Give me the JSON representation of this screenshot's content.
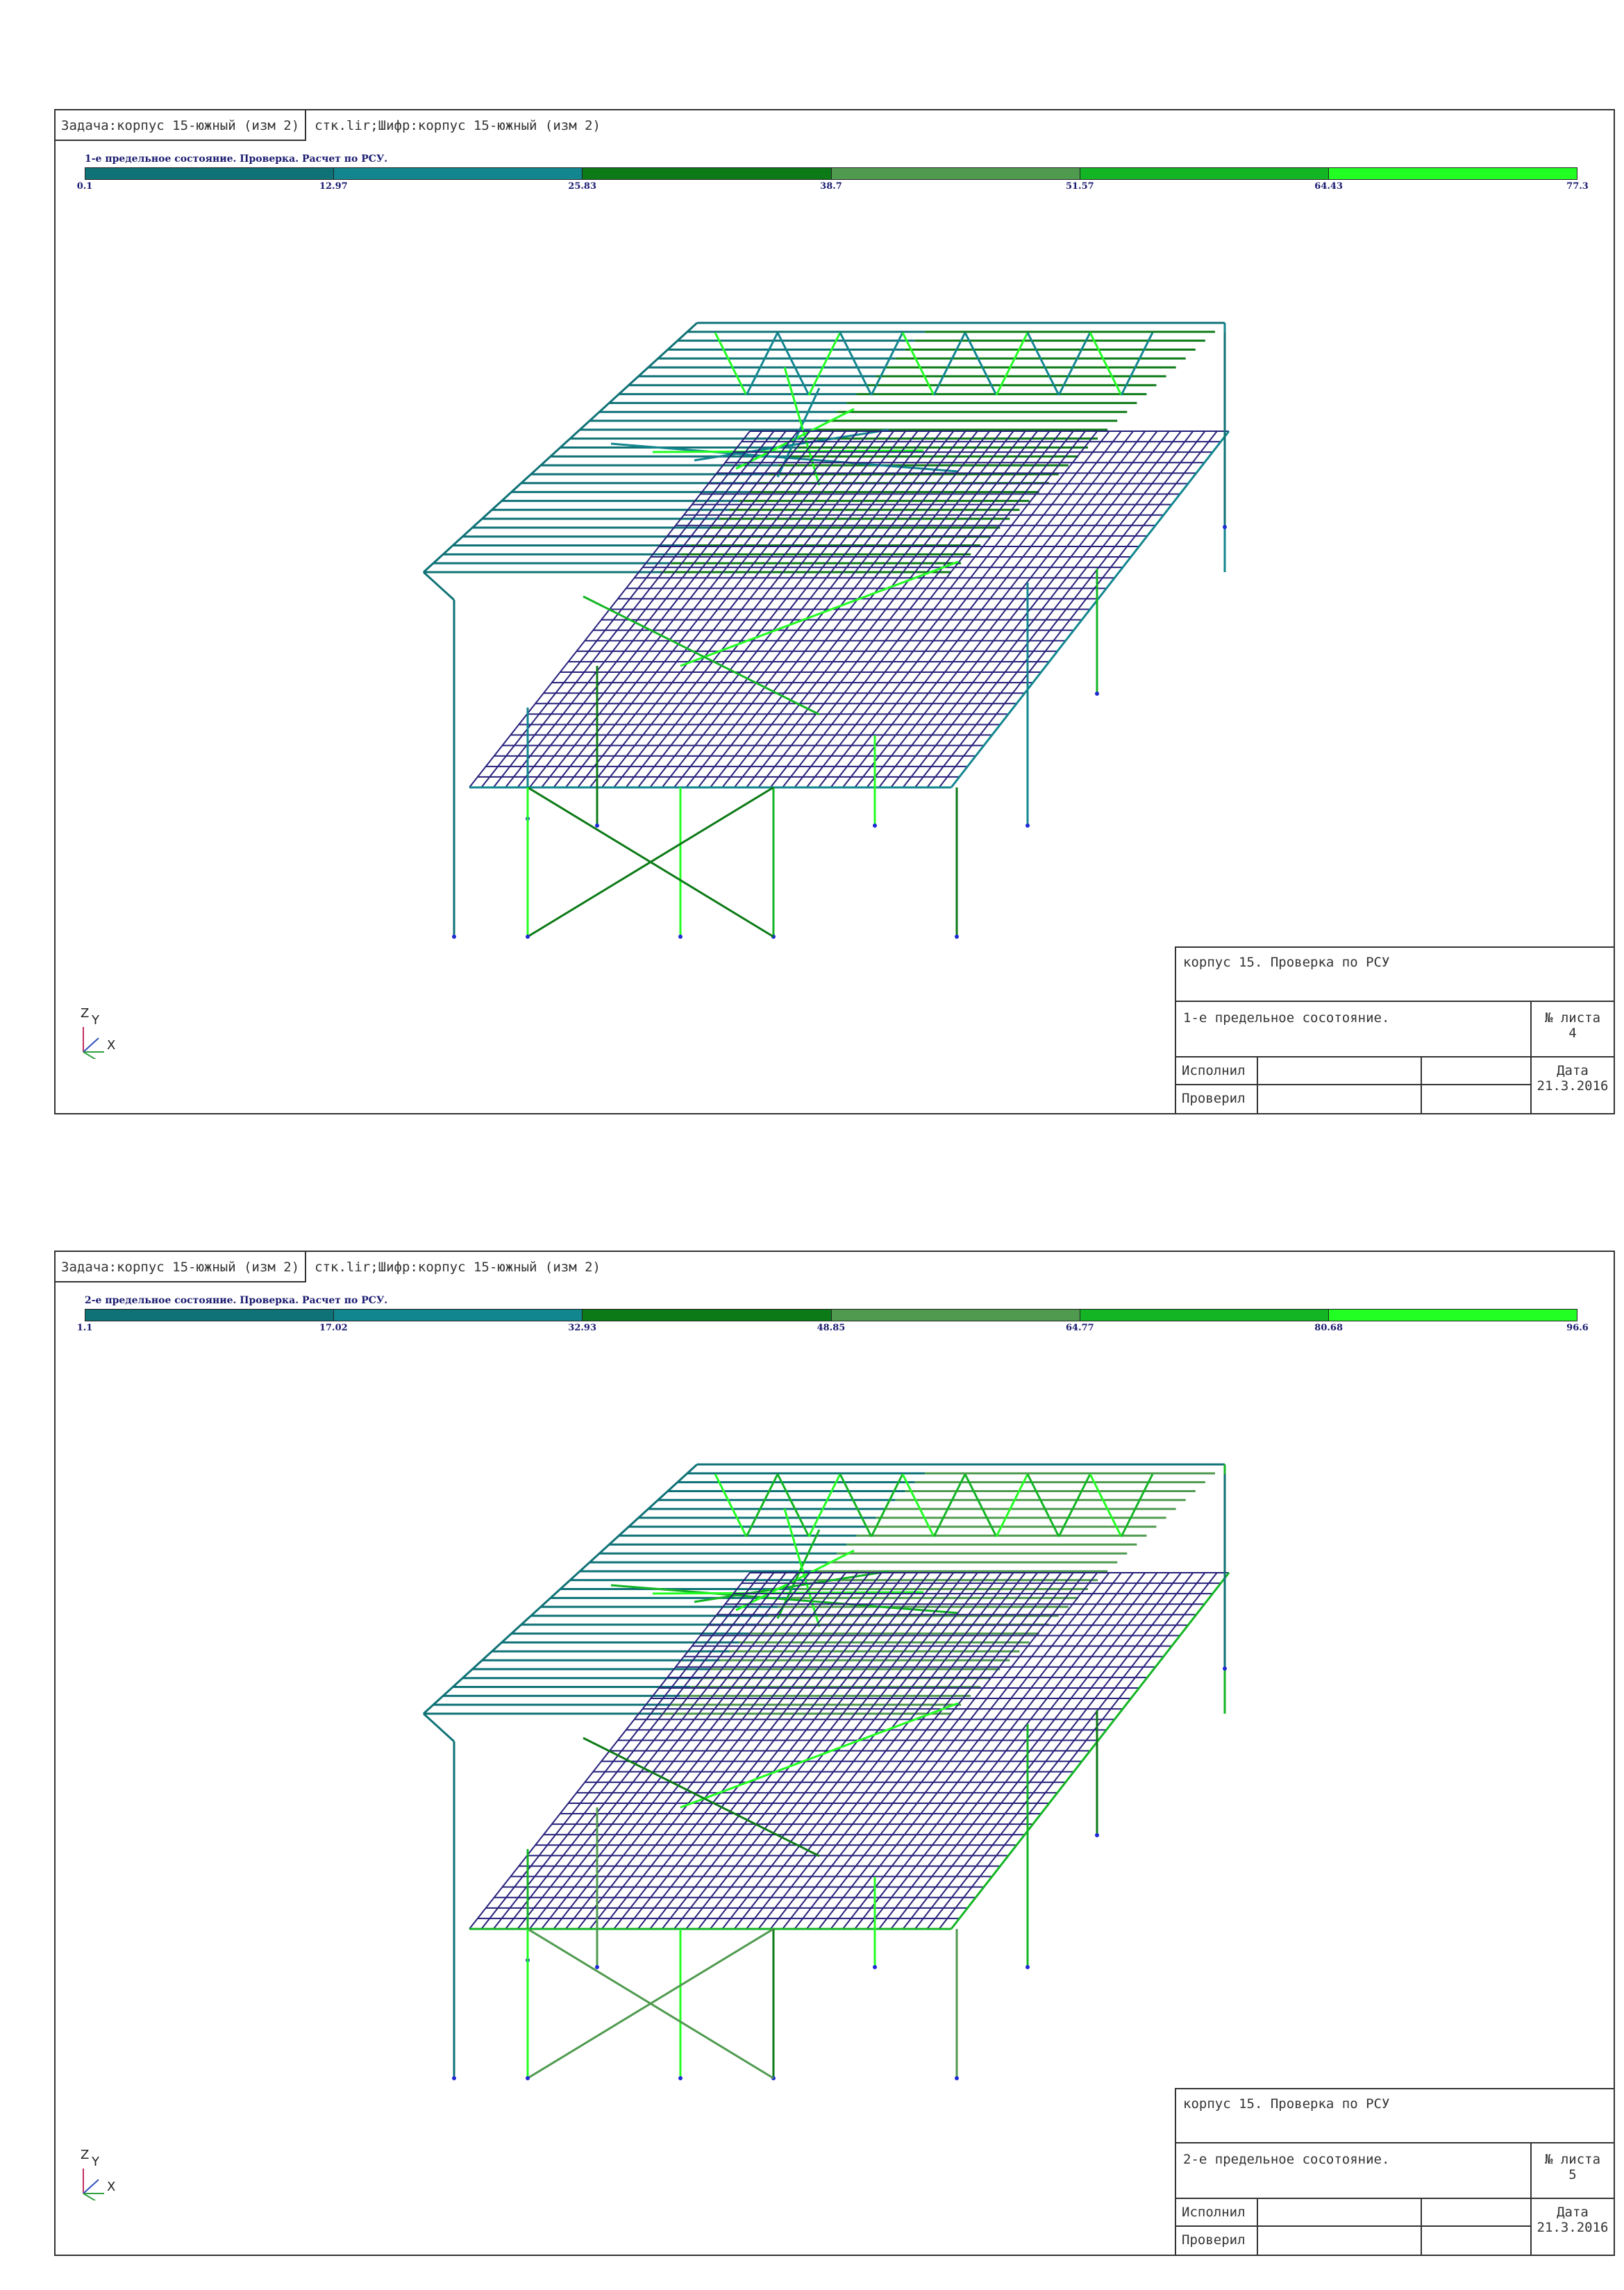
{
  "sheets": [
    {
      "task_label": "Задача:корпус 15-южный (изм 2)",
      "code_label": "стк.lir;Шифр:корпус 15-южный (изм 2)",
      "scale_title": "1-е предельное состояние. Проверка. Расчет по РСУ.",
      "scale_ticks": [
        "0.1",
        "12.97",
        "25.83",
        "38.7",
        "51.57",
        "64.43",
        "77.3"
      ],
      "axes": {
        "z": "Z",
        "y": "Y",
        "x": "X"
      },
      "stamp": {
        "project": "корпус 15. Проверка по РСУ",
        "state": "1-е предельное сосотояние.",
        "sheet_no_label": "№ листа",
        "sheet_no": "4",
        "performed_label": "Исполнил",
        "checked_label": "Проверил",
        "date_label": "Дата",
        "date": "21.3.2016"
      }
    },
    {
      "task_label": "Задача:корпус 15-южный (изм 2)",
      "code_label": "стк.lir;Шифр:корпус 15-южный (изм 2)",
      "scale_title": "2-е предельное состояние. Проверка. Расчет по РСУ.",
      "scale_ticks": [
        "1.1",
        "17.02",
        "32.93",
        "48.85",
        "64.77",
        "80.68",
        "96.6"
      ],
      "axes": {
        "z": "Z",
        "y": "Y",
        "x": "X"
      },
      "stamp": {
        "project": "корпус 15. Проверка по РСУ",
        "state": "2-е предельное сосотояние.",
        "sheet_no_label": "№ листа",
        "sheet_no": "5",
        "performed_label": "Исполнил",
        "checked_label": "Проверил",
        "date_label": "Дата",
        "date": "21.3.2016"
      }
    }
  ],
  "scale_colors": [
    "#0f7276",
    "#12868f",
    "#0c7a16",
    "#4f9a4f",
    "#13b524",
    "#22ff22"
  ],
  "colors": {
    "slab": "#26207a",
    "dark_teal": "#0f7276",
    "teal": "#12868f",
    "dark_green": "#0c7a16",
    "mid_green": "#4f9a4f",
    "green": "#13b524",
    "lime": "#22ff22",
    "support": "#1e2ad6"
  }
}
